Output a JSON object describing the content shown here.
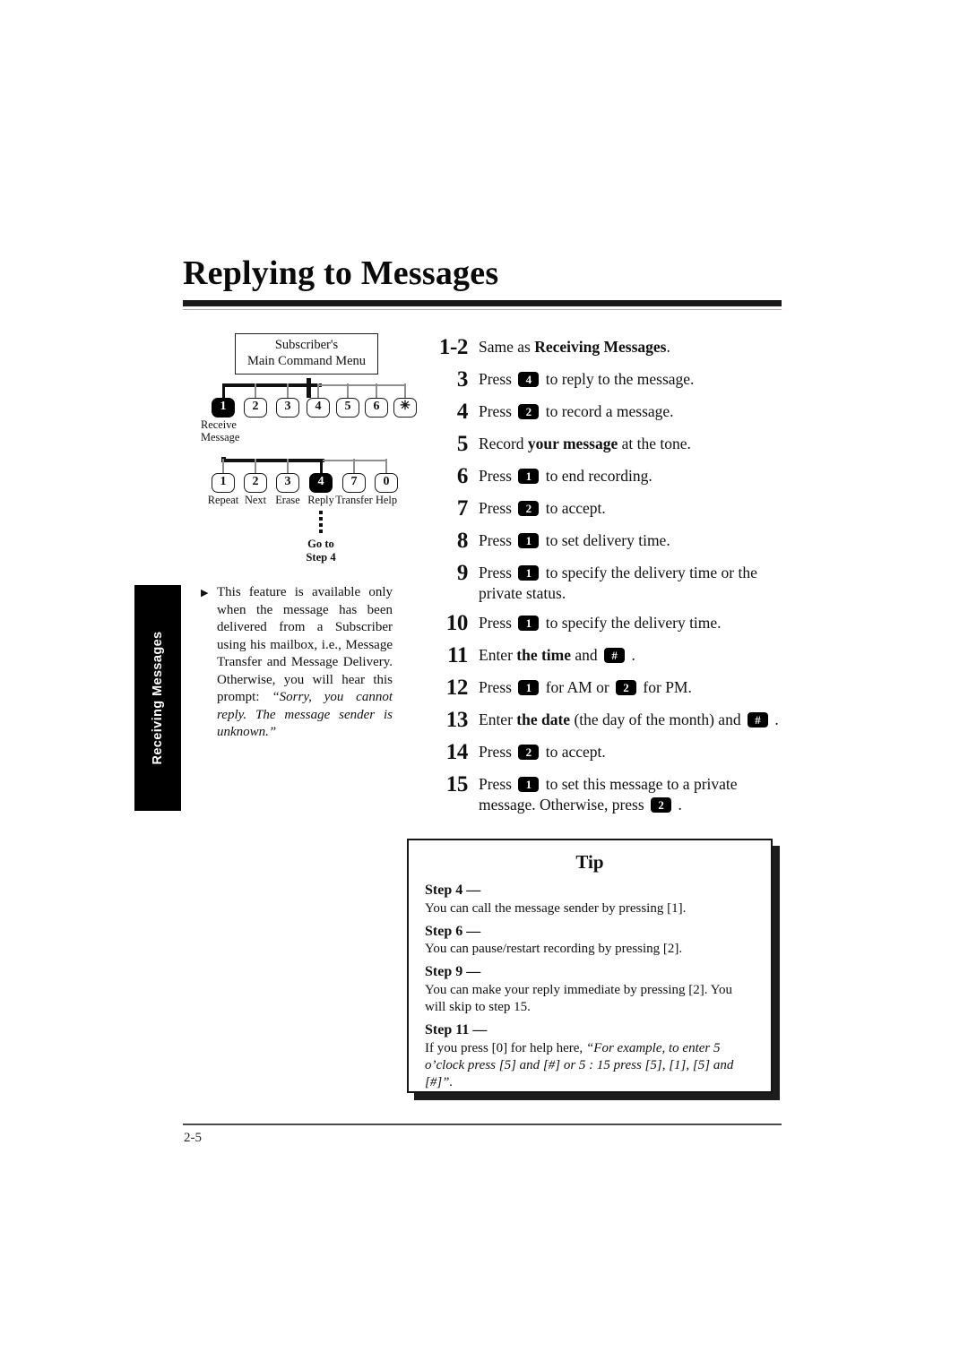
{
  "document": {
    "title": "Replying to Messages",
    "page_number": "2-5",
    "side_tab_label": "Receiving Messages"
  },
  "diagram": {
    "menu_box": {
      "line1": "Subscriber's",
      "line2": "Main Command Menu"
    },
    "row1_keys": [
      {
        "key": "1",
        "filled": true
      },
      {
        "key": "2",
        "filled": false
      },
      {
        "key": "3",
        "filled": false
      },
      {
        "key": "4",
        "filled": false
      },
      {
        "key": "5",
        "filled": false
      },
      {
        "key": "6",
        "filled": false
      },
      {
        "key": "✳",
        "filled": false
      }
    ],
    "row1_label": {
      "line1": "Receive",
      "line2": "Message"
    },
    "row2_keys": [
      {
        "key": "1",
        "label": "Repeat",
        "filled": false
      },
      {
        "key": "2",
        "label": "Next",
        "filled": false
      },
      {
        "key": "3",
        "label": "Erase",
        "filled": false
      },
      {
        "key": "4",
        "label": "Reply",
        "filled": true
      },
      {
        "key": "7",
        "label": "Transfer",
        "filled": false
      },
      {
        "key": "0",
        "label": "Help",
        "filled": false
      }
    ],
    "goto": {
      "line1": "Go to",
      "line2": "Step 4"
    }
  },
  "note": {
    "bullet_icon": "▶",
    "text": "This feature is available only when the message has been delivered from a Subscriber using his mailbox, i.e., Message Transfer and Message Delivery. Otherwise, you will hear this prompt: ",
    "italic_text": "“Sorry, you cannot reply. The message sender is unknown.”"
  },
  "steps": [
    {
      "num": "1-2",
      "parts": [
        {
          "t": "text",
          "v": "Same as "
        },
        {
          "t": "bold",
          "v": "Receiving Messages"
        },
        {
          "t": "text",
          "v": "."
        }
      ]
    },
    {
      "num": "3",
      "parts": [
        {
          "t": "text",
          "v": "Press "
        },
        {
          "t": "key",
          "v": "4"
        },
        {
          "t": "text",
          "v": " to reply to the message."
        }
      ]
    },
    {
      "num": "4",
      "parts": [
        {
          "t": "text",
          "v": "Press "
        },
        {
          "t": "key",
          "v": "2"
        },
        {
          "t": "text",
          "v": " to record a message."
        }
      ]
    },
    {
      "num": "5",
      "parts": [
        {
          "t": "text",
          "v": "Record "
        },
        {
          "t": "bold",
          "v": "your message"
        },
        {
          "t": "text",
          "v": " at the tone."
        }
      ]
    },
    {
      "num": "6",
      "parts": [
        {
          "t": "text",
          "v": "Press "
        },
        {
          "t": "key",
          "v": "1"
        },
        {
          "t": "text",
          "v": " to end recording."
        }
      ]
    },
    {
      "num": "7",
      "parts": [
        {
          "t": "text",
          "v": "Press "
        },
        {
          "t": "key",
          "v": "2"
        },
        {
          "t": "text",
          "v": " to accept."
        }
      ]
    },
    {
      "num": "8",
      "parts": [
        {
          "t": "text",
          "v": "Press "
        },
        {
          "t": "key",
          "v": "1"
        },
        {
          "t": "text",
          "v": " to set delivery time."
        }
      ]
    },
    {
      "num": "9",
      "parts": [
        {
          "t": "text",
          "v": "Press "
        },
        {
          "t": "key",
          "v": "1"
        },
        {
          "t": "text",
          "v": " to specify the delivery time or the private status."
        }
      ]
    },
    {
      "num": "10",
      "parts": [
        {
          "t": "text",
          "v": "Press "
        },
        {
          "t": "key",
          "v": "1"
        },
        {
          "t": "text",
          "v": " to specify the delivery time."
        }
      ]
    },
    {
      "num": "11",
      "parts": [
        {
          "t": "text",
          "v": "Enter "
        },
        {
          "t": "bold",
          "v": "the time"
        },
        {
          "t": "text",
          "v": " and "
        },
        {
          "t": "key",
          "v": "#"
        },
        {
          "t": "text",
          "v": " ."
        }
      ]
    },
    {
      "num": "12",
      "parts": [
        {
          "t": "text",
          "v": "Press "
        },
        {
          "t": "key",
          "v": "1"
        },
        {
          "t": "text",
          "v": " for AM or "
        },
        {
          "t": "key",
          "v": "2"
        },
        {
          "t": "text",
          "v": " for PM."
        }
      ]
    },
    {
      "num": "13",
      "parts": [
        {
          "t": "text",
          "v": "Enter "
        },
        {
          "t": "bold",
          "v": "the date"
        },
        {
          "t": "text",
          "v": " (the day of the month) and "
        },
        {
          "t": "key",
          "v": "#"
        },
        {
          "t": "text",
          "v": " ."
        }
      ]
    },
    {
      "num": "14",
      "parts": [
        {
          "t": "text",
          "v": "Press "
        },
        {
          "t": "key",
          "v": "2"
        },
        {
          "t": "text",
          "v": " to accept."
        }
      ]
    },
    {
      "num": "15",
      "parts": [
        {
          "t": "text",
          "v": "Press "
        },
        {
          "t": "key",
          "v": "1"
        },
        {
          "t": "text",
          "v": " to set this message to a private message. Otherwise, press "
        },
        {
          "t": "key",
          "v": "2"
        },
        {
          "t": "text",
          "v": " ."
        }
      ]
    }
  ],
  "tip": {
    "title": "Tip",
    "entries": [
      {
        "head": "Step 4 —",
        "body": "You can call the message sender by pressing [1].",
        "italic": ""
      },
      {
        "head": "Step 6 —",
        "body": "You can pause/restart recording by pressing [2].",
        "italic": ""
      },
      {
        "head": "Step 9 —",
        "body": "You can make your reply immediate by pressing [2]. You will skip to step 15.",
        "italic": ""
      },
      {
        "head": "Step 11 —",
        "body": "If you press [0] for help here, ",
        "italic": "“For example, to enter 5 o’clock press [5] and [#] or 5 : 15 press [5], [1], [5] and [#]”."
      }
    ]
  }
}
